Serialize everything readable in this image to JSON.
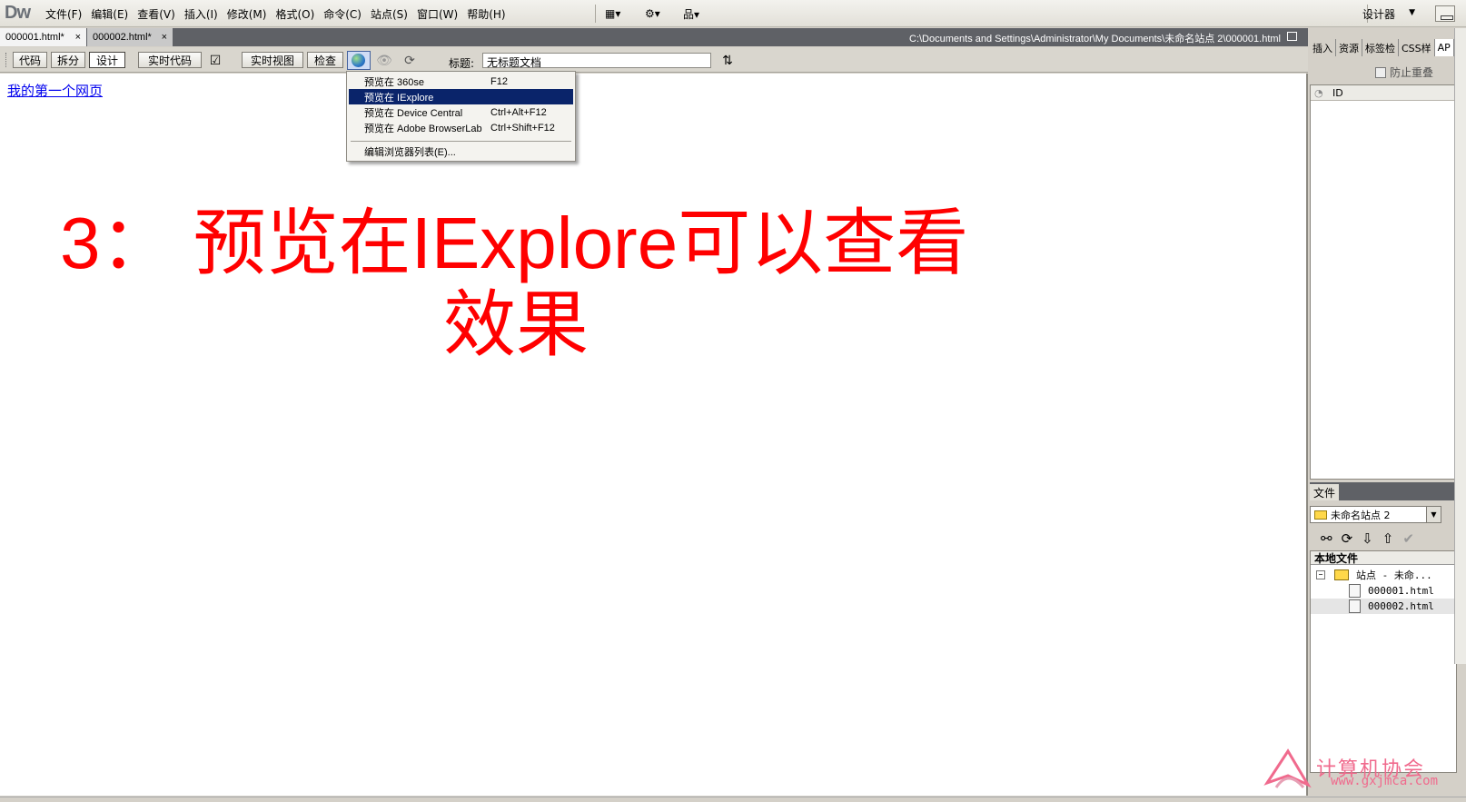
{
  "app": {
    "logo": "Dw",
    "menus": [
      "文件(F)",
      "编辑(E)",
      "查看(V)",
      "插入(I)",
      "修改(M)",
      "格式(O)",
      "命令(C)",
      "站点(S)",
      "窗口(W)",
      "帮助(H)"
    ],
    "workspace": "设计器"
  },
  "tabs": [
    {
      "label": "000001.html*"
    },
    {
      "label": "000002.html*"
    }
  ],
  "doc_path": "C:\\Documents and Settings\\Administrator\\My Documents\\未命名站点 2\\000001.html",
  "toolbar": {
    "code": "代码",
    "split": "拆分",
    "design": "设计",
    "live_code": "实时代码",
    "live_view": "实时视图",
    "inspect": "检查",
    "title_label": "标题:",
    "title_value": "无标题文档"
  },
  "canvas": {
    "link_text": "我的第一个网页",
    "caption_line1": "3： 预览在IExplore可以查看",
    "caption_line2": "效果"
  },
  "preview_menu": {
    "items": [
      {
        "label": "预览在 360se",
        "shortcut": "F12"
      },
      {
        "label": "预览在 IExplore",
        "shortcut": ""
      },
      {
        "label": "预览在 Device Central",
        "shortcut": "Ctrl+Alt+F12"
      },
      {
        "label": "预览在 Adobe BrowserLab",
        "shortcut": "Ctrl+Shift+F12"
      }
    ],
    "edit_list": "编辑浏览器列表(E)...",
    "selected_index": 1
  },
  "right_panel": {
    "tabs": [
      "插入",
      "资源",
      "标签检",
      "CSS样",
      "AP"
    ],
    "prevent_overlap": "防止重叠",
    "ap_header": "ID",
    "files_tab": "文件",
    "site_name": "未命名站点 2",
    "local_files": "本地文件",
    "tree_root": "站点 - 未命...",
    "files": [
      "000001.html",
      "000002.html"
    ]
  },
  "watermark": {
    "text": "计算机协会",
    "url": "www.gxjmca.com"
  },
  "colors": {
    "caption": "#ff0000",
    "menu_selection": "#0a246a",
    "link": "#0000ee",
    "watermark": "#f06a8d"
  }
}
